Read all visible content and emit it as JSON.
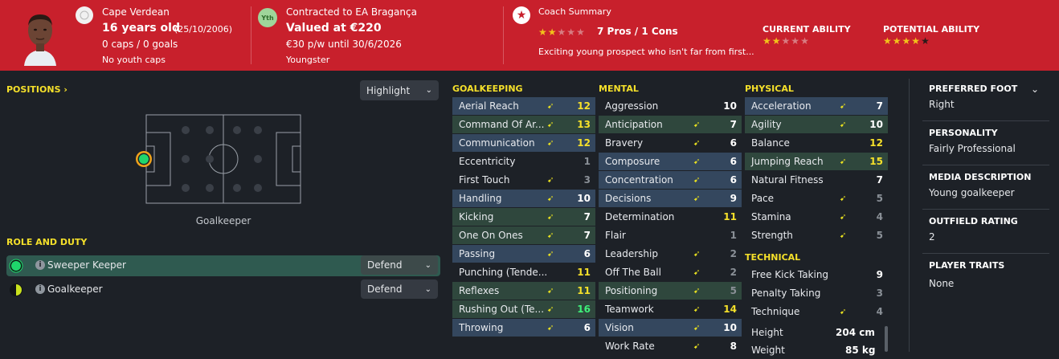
{
  "header": {
    "nationality": "Cape Verdean",
    "age": "16 years old",
    "dob": "(25/10/2006)",
    "caps": "0 caps / 0 goals",
    "youth_caps": "No youth caps",
    "club_badge": "Yth",
    "contract": "Contracted to EA Bragança",
    "value": "Valued at €220",
    "wage": "€30 p/w until 30/6/2026",
    "status": "Youngster",
    "coach_summary_title": "Coach Summary",
    "pros_cons": "7 Pros / 1 Cons",
    "summary_text": "Exciting young prospect who isn't far from first...",
    "current_ability_label": "CURRENT ABILITY",
    "potential_ability_label": "POTENTIAL ABILITY",
    "coach_stars": 2,
    "current_ability_stars": 2,
    "potential_ability_stars": 4,
    "colors": {
      "header_bg": "#c8202c",
      "star": "#f2c21b"
    }
  },
  "positions": {
    "label": "POSITIONS",
    "highlight_label": "Highlight",
    "position_name": "Goalkeeper"
  },
  "role_duty": {
    "label": "ROLE AND DUTY",
    "roles": [
      {
        "name": "Sweeper Keeper",
        "duty": "Defend"
      },
      {
        "name": "Goalkeeper",
        "duty": "Defend"
      }
    ]
  },
  "goalkeeping": {
    "title": "GOALKEEPING",
    "attributes": [
      {
        "name": "Aerial Reach",
        "value": "12"
      },
      {
        "name": "Command Of Ar...",
        "value": "13"
      },
      {
        "name": "Communication",
        "value": "12"
      },
      {
        "name": "Eccentricity",
        "value": "1"
      },
      {
        "name": "First Touch",
        "value": "3"
      },
      {
        "name": "Handling",
        "value": "10"
      },
      {
        "name": "Kicking",
        "value": "7"
      },
      {
        "name": "One On Ones",
        "value": "7"
      },
      {
        "name": "Passing",
        "value": "6"
      },
      {
        "name": "Punching (Tende...",
        "value": "11"
      },
      {
        "name": "Reflexes",
        "value": "11"
      },
      {
        "name": "Rushing Out (Te...",
        "value": "16"
      },
      {
        "name": "Throwing",
        "value": "6"
      }
    ]
  },
  "mental": {
    "title": "MENTAL",
    "attributes": [
      {
        "name": "Aggression",
        "value": "10"
      },
      {
        "name": "Anticipation",
        "value": "7"
      },
      {
        "name": "Bravery",
        "value": "6"
      },
      {
        "name": "Composure",
        "value": "6"
      },
      {
        "name": "Concentration",
        "value": "6"
      },
      {
        "name": "Decisions",
        "value": "9"
      },
      {
        "name": "Determination",
        "value": "11"
      },
      {
        "name": "Flair",
        "value": "1"
      },
      {
        "name": "Leadership",
        "value": "2"
      },
      {
        "name": "Off The Ball",
        "value": "2"
      },
      {
        "name": "Positioning",
        "value": "5"
      },
      {
        "name": "Teamwork",
        "value": "14"
      },
      {
        "name": "Vision",
        "value": "10"
      },
      {
        "name": "Work Rate",
        "value": "8"
      }
    ]
  },
  "physical": {
    "title": "PHYSICAL",
    "attributes": [
      {
        "name": "Acceleration",
        "value": "7"
      },
      {
        "name": "Agility",
        "value": "10"
      },
      {
        "name": "Balance",
        "value": "12"
      },
      {
        "name": "Jumping Reach",
        "value": "15"
      },
      {
        "name": "Natural Fitness",
        "value": "7"
      },
      {
        "name": "Pace",
        "value": "5"
      },
      {
        "name": "Stamina",
        "value": "4"
      },
      {
        "name": "Strength",
        "value": "5"
      }
    ]
  },
  "technical": {
    "title": "TECHNICAL",
    "attributes": [
      {
        "name": "Free Kick Taking",
        "value": "9"
      },
      {
        "name": "Penalty Taking",
        "value": "3"
      },
      {
        "name": "Technique",
        "value": "4"
      }
    ]
  },
  "body": {
    "height_label": "Height",
    "height": "204 cm",
    "weight_label": "Weight",
    "weight": "85 kg"
  },
  "info": {
    "preferred_foot_label": "PREFERRED FOOT",
    "preferred_foot": "Right",
    "personality_label": "PERSONALITY",
    "personality": "Fairly Professional",
    "media_label": "MEDIA DESCRIPTION",
    "media": "Young goalkeeper",
    "outfield_label": "OUTFIELD RATING",
    "outfield": "2",
    "traits_label": "PLAYER TRAITS",
    "traits": "None"
  }
}
